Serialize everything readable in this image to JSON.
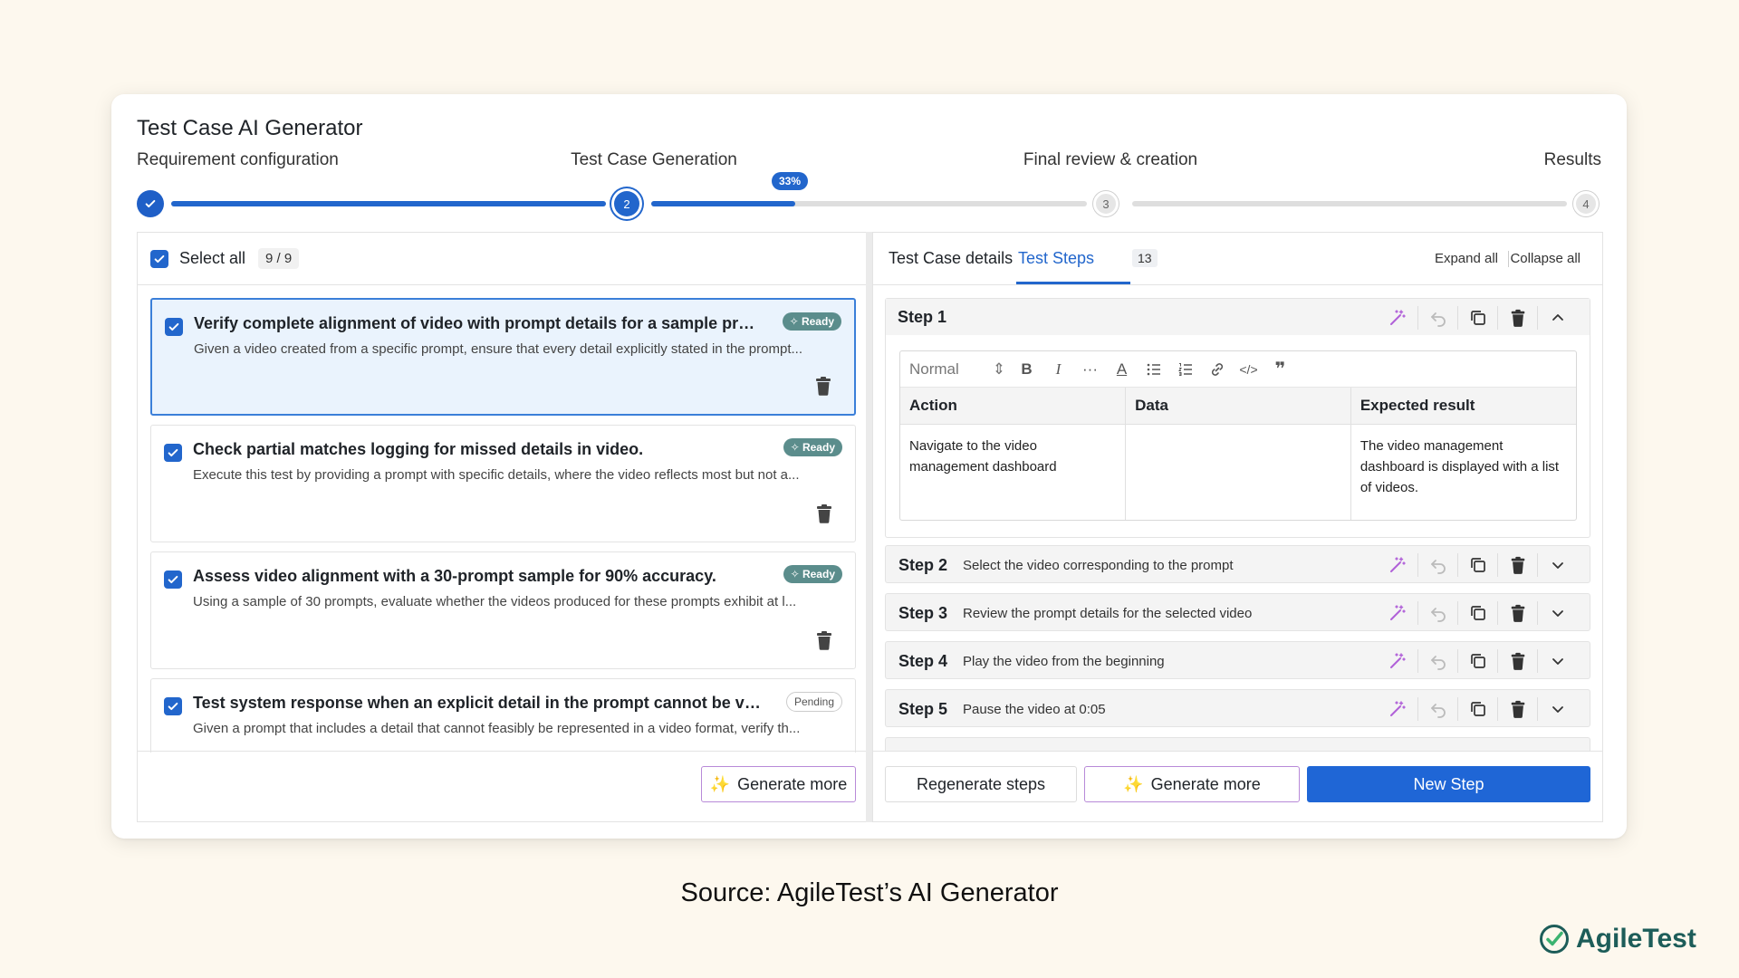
{
  "app": {
    "title": "Test Case AI Generator"
  },
  "stages": [
    {
      "label": "Requirement configuration",
      "state": "done"
    },
    {
      "label": "Test Case Generation",
      "state": "current",
      "number": "2"
    },
    {
      "label": "Final review & creation",
      "state": "todo",
      "number": "3"
    },
    {
      "label": "Results",
      "state": "todo",
      "number": "4"
    }
  ],
  "progress": {
    "label": "33%",
    "value": 0.33
  },
  "test_cases": {
    "select_all_label": "Select all",
    "count": "9 / 9",
    "items": [
      {
        "title": "Verify complete alignment of video with prompt details for a sample prom...",
        "description": "Given a video created from a specific prompt, ensure that every detail explicitly stated in the prompt...",
        "status": "Ready",
        "checked": true,
        "active": true
      },
      {
        "title": "Check partial matches logging for missed details in video.",
        "description": "Execute this test by providing a prompt with specific details, where the video reflects most but not a...",
        "status": "Ready",
        "checked": true,
        "active": false
      },
      {
        "title": "Assess video alignment with a 30-prompt sample for 90% accuracy.",
        "description": "Using a sample of 30 prompts, evaluate whether the videos produced for these prompts exhibit at l...",
        "status": "Ready",
        "checked": true,
        "active": false
      },
      {
        "title": "Test system response when an explicit detail in the prompt cannot be visu...",
        "description": "Given a prompt that includes a detail that cannot feasibly be represented in a video format, verify th...",
        "status": "Pending",
        "checked": true,
        "active": false
      }
    ],
    "generate_more_label": "Generate more"
  },
  "details": {
    "tabs": [
      {
        "label": "Test Case details"
      },
      {
        "label": "Test Steps",
        "count": "13"
      }
    ],
    "expand_all": "Expand all",
    "collapse_all": "Collapse all",
    "editor": {
      "format_select": "Normal",
      "columns": [
        "Action",
        "Data",
        "Expected result"
      ],
      "row": {
        "action": "Navigate to the video management dashboard",
        "data": "",
        "expected": "The video management dashboard is displayed with a list of videos."
      }
    },
    "steps": [
      {
        "label": "Step 1",
        "text": ""
      },
      {
        "label": "Step 2",
        "text": "Select the video corresponding to the prompt"
      },
      {
        "label": "Step 3",
        "text": "Review the prompt details for the selected video"
      },
      {
        "label": "Step 4",
        "text": "Play the video from the beginning"
      },
      {
        "label": "Step 5",
        "text": "Pause the video at 0:05"
      }
    ],
    "regenerate_label": "Regenerate steps",
    "generate_more_label": "Generate more",
    "new_step_label": "New Step"
  },
  "caption": "Source: AgileTest’s AI Generator",
  "brand": "AgileTest",
  "colors": {
    "primary": "#2266cc",
    "ready": "#5b8d8c",
    "accent_purple": "#b060d8",
    "brand": "#1d5d59"
  }
}
